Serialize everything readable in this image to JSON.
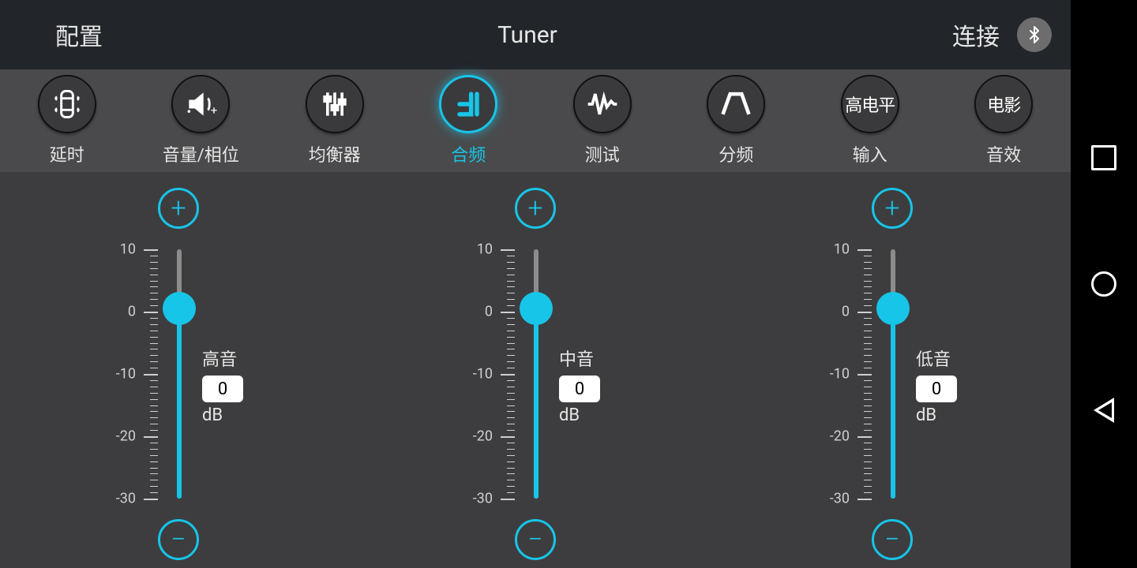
{
  "header": {
    "left_label": "配置",
    "title": "Tuner",
    "right_label": "连接"
  },
  "tabs": [
    {
      "id": "delay",
      "label": "延时",
      "icon": "car-icon"
    },
    {
      "id": "volume",
      "label": "音量/相位",
      "icon": "speaker-icon"
    },
    {
      "id": "eq",
      "label": "均衡器",
      "icon": "sliders-icon"
    },
    {
      "id": "combine",
      "label": "合频",
      "icon": "combine-icon",
      "active": true
    },
    {
      "id": "test",
      "label": "测试",
      "icon": "wave-icon"
    },
    {
      "id": "cross",
      "label": "分频",
      "icon": "trapezoid-icon"
    },
    {
      "id": "input",
      "label": "输入",
      "text": "高电平"
    },
    {
      "id": "fx",
      "label": "音效",
      "text": "电影"
    }
  ],
  "scale": {
    "max": 10,
    "min": -30,
    "majors": [
      10,
      0,
      -10,
      -20,
      -30
    ]
  },
  "sliders": [
    {
      "name": "高音",
      "value": 0,
      "unit": "dB"
    },
    {
      "name": "中音",
      "value": 0,
      "unit": "dB"
    },
    {
      "name": "低音",
      "value": 0,
      "unit": "dB"
    }
  ],
  "buttons": {
    "plus": "+",
    "minus": "−"
  },
  "accent": "#17c5e8"
}
